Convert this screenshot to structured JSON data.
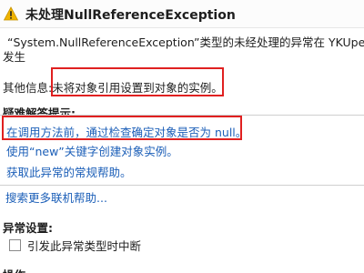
{
  "title_bar": {
    "icon": "warning-triangle-icon",
    "title": "未处理NullReferenceException"
  },
  "message": {
    "line1": "“System.NullReferenceException”类型的未经处理的异常在 YKUper.exe 中",
    "line2": "发生"
  },
  "other_info": {
    "label": "其他信息:",
    "value": "未将对象引用设置到对象的实例。"
  },
  "troubleshooting": {
    "heading": "疑难解答提示:",
    "tips": [
      "在调用方法前，通过检查确定对象是否为 null。",
      "使用“new”关键字创建对象实例。",
      "获取此异常的常规帮助。"
    ]
  },
  "links": {
    "search_online": "搜索更多联机帮助..."
  },
  "exception_settings": {
    "heading": "异常设置:",
    "checkbox_label": "引发此异常类型时中断",
    "checked": false
  },
  "actions": {
    "heading": "操作:"
  },
  "colors": {
    "highlight_border": "#e02020",
    "link": "#1c5fb8",
    "warning": "#f0b400"
  }
}
